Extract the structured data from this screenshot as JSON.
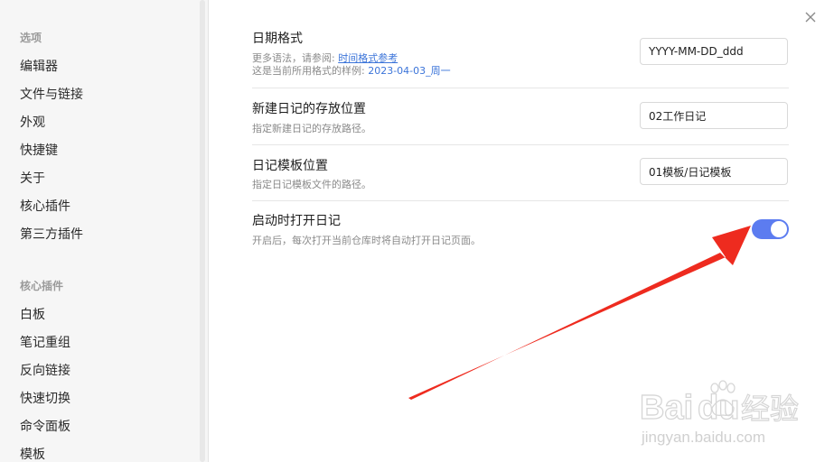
{
  "sidebar": {
    "section_options": "选项",
    "options_items": [
      "编辑器",
      "文件与链接",
      "外观",
      "快捷键",
      "关于",
      "核心插件",
      "第三方插件"
    ],
    "section_core_plugins": "核心插件",
    "core_plugin_items": [
      "白板",
      "笔记重组",
      "反向链接",
      "快速切换",
      "命令面板",
      "模板"
    ]
  },
  "settings": {
    "date_format": {
      "title": "日期格式",
      "desc_prefix": "更多语法，请参阅: ",
      "desc_link": "时间格式参考",
      "sample_prefix": "这是当前所用格式的样例: ",
      "sample_value": "2023-04-03_周一",
      "value": "YYYY-MM-DD_ddd"
    },
    "new_note_location": {
      "title": "新建日记的存放位置",
      "desc": "指定新建日记的存放路径。",
      "value": "02工作日记"
    },
    "template_location": {
      "title": "日记模板位置",
      "desc": "指定日记模板文件的路径。",
      "value": "01模板/日记模板"
    },
    "open_on_startup": {
      "title": "启动时打开日记",
      "desc": "开启后，每次打开当前仓库时将自动打开日记页面。",
      "enabled": true
    }
  },
  "watermark": {
    "brand": "Bai",
    "brand2": "du",
    "suffix": "经验",
    "url": "jingyan.baidu.com"
  },
  "colors": {
    "accent": "#3b74d9",
    "toggle_on": "#5c7cf0",
    "arrow": "#ee2b1f"
  },
  "icons": {
    "close": "close-icon",
    "arrow": "red-arrow-annotation"
  }
}
